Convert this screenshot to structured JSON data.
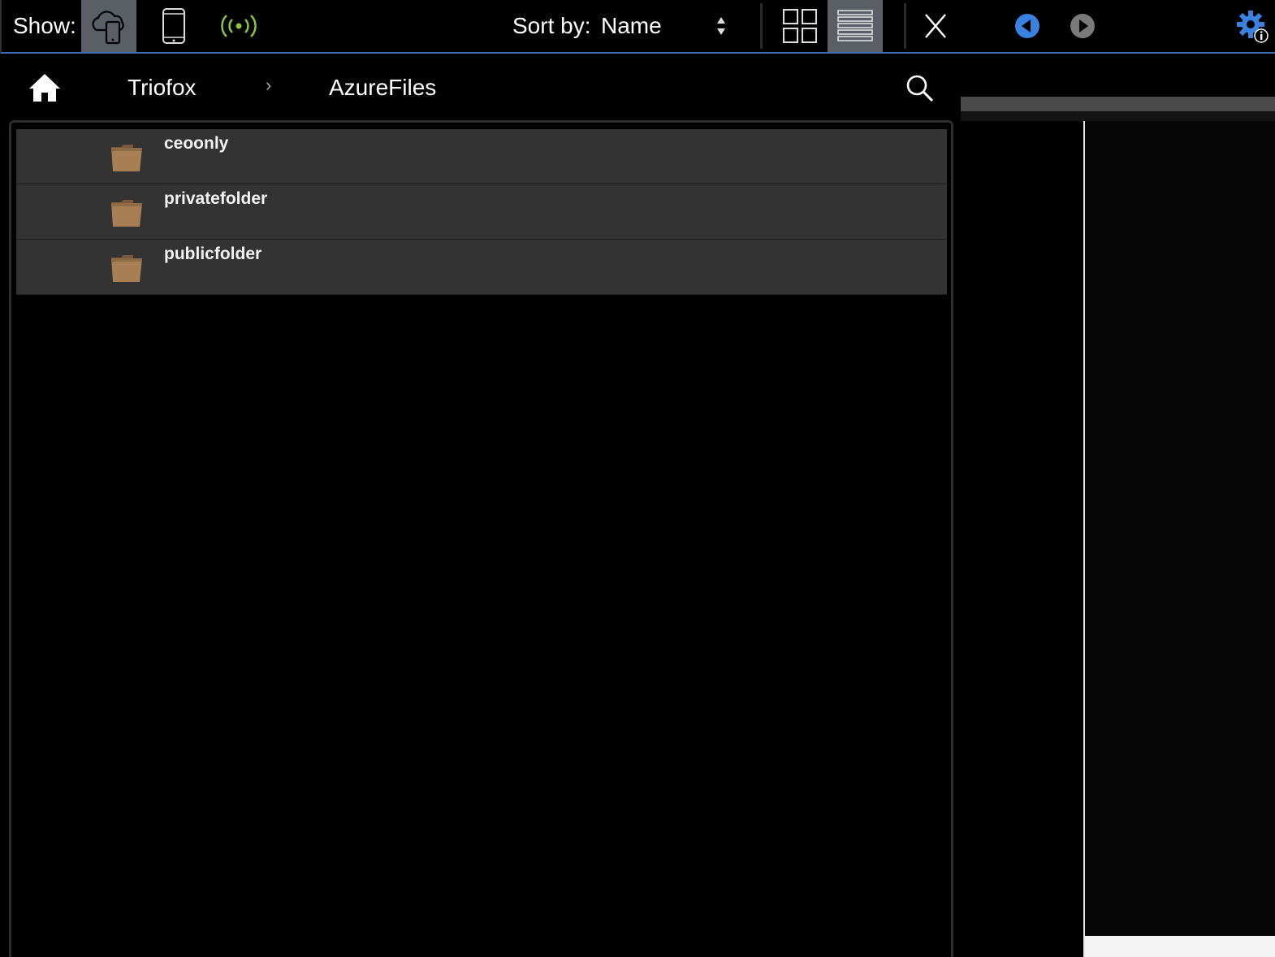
{
  "toolbar": {
    "show_label": "Show:",
    "sort_label": "Sort by:",
    "sort_value": "Name",
    "close_label": "X",
    "accent_color": "#3d6fb3",
    "wifi_color": "#8cc63f",
    "back_color": "#3b82e0",
    "settings_color": "#3b82e0",
    "icons": {
      "cloud": "cloud-device-icon",
      "device": "tablet-icon",
      "wifi": "wireless-signal-icon",
      "grid": "grid-view-icon",
      "list": "list-view-icon",
      "back": "back-arrow-icon",
      "forward": "forward-arrow-icon",
      "settings": "gear-info-icon"
    }
  },
  "breadcrumb": {
    "items": [
      "Triofox",
      "AzureFiles"
    ],
    "separator": "›"
  },
  "files": [
    {
      "name": "ceoonly",
      "type": "folder"
    },
    {
      "name": "privatefolder",
      "type": "folder"
    },
    {
      "name": "publicfolder",
      "type": "folder"
    }
  ],
  "colors": {
    "folder": "#a87e54",
    "row_bg": "#333333",
    "active_button": "#5a5f66"
  }
}
